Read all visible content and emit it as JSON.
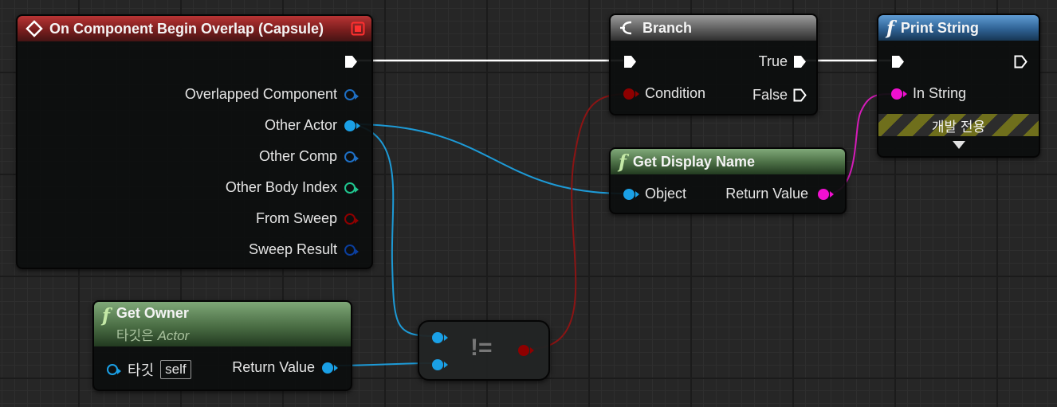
{
  "event_node": {
    "title": "On Component Begin Overlap (Capsule)",
    "pins": [
      {
        "label": "Overlapped Component",
        "color": "#1e6fc4"
      },
      {
        "label": "Other Actor",
        "color": "#1aa0e6"
      },
      {
        "label": "Other Comp",
        "color": "#1e6fc4"
      },
      {
        "label": "Other Body Index",
        "color": "#20c58f"
      },
      {
        "label": "From Sweep",
        "color": "#8e0000"
      },
      {
        "label": "Sweep Result",
        "color": "#0b3e9c"
      }
    ]
  },
  "branch_node": {
    "title": "Branch",
    "condition_label": "Condition",
    "true_label": "True",
    "false_label": "False"
  },
  "print_string_node": {
    "title": "Print String",
    "in_string_label": "In String",
    "dev_only_label": "개발 전용"
  },
  "get_display_name_node": {
    "title": "Get Display Name",
    "object_label": "Object",
    "return_label": "Return Value"
  },
  "get_owner_node": {
    "title": "Get Owner",
    "subtitle_prefix": "타깃은",
    "subtitle_class": "Actor",
    "target_label": "타깃",
    "self_value": "self",
    "return_label": "Return Value"
  },
  "not_equal_node": {
    "operator": "!="
  },
  "colors": {
    "exec": "#ffffff",
    "object": "#1aa0e6",
    "bool": "#8e0000",
    "string": "#f010d0",
    "wire_object": "#1d9ad6",
    "wire_bool": "#8b1414",
    "wire_string": "#d41cb8"
  },
  "icons": {
    "event": "event-diamond-icon",
    "branch": "branch-icon",
    "function": "function-icon",
    "expand": "expand-arrow-icon",
    "delegate": "delegate-square-icon"
  }
}
